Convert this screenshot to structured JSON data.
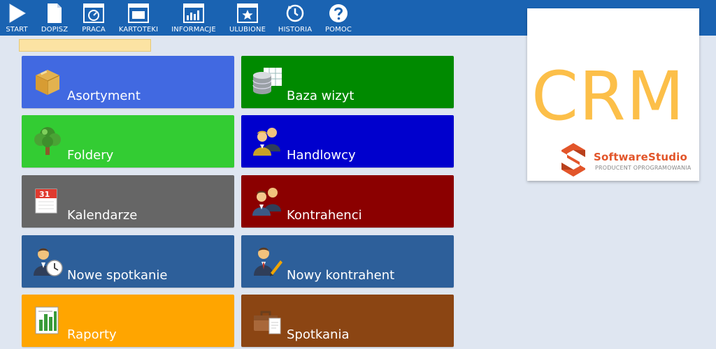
{
  "toolbar": {
    "items": [
      {
        "label": "START",
        "icon": "play-icon"
      },
      {
        "label": "DOPISZ",
        "icon": "document-icon"
      },
      {
        "label": "PRACA",
        "icon": "gauge-icon"
      },
      {
        "label": "KARTOTEKI",
        "icon": "window-icon"
      },
      {
        "label": "INFORMACJE",
        "icon": "bar-chart-icon"
      },
      {
        "label": "ULUBIONE",
        "icon": "star-icon"
      },
      {
        "label": "HISTORIA",
        "icon": "history-icon"
      },
      {
        "label": "POMOC",
        "icon": "help-icon"
      }
    ]
  },
  "search": {
    "value": ""
  },
  "tiles": [
    {
      "label": "Asortyment",
      "color": "#4169e1",
      "icon": "box-icon"
    },
    {
      "label": "Baza wizyt",
      "color": "#008a00",
      "icon": "database-icon"
    },
    {
      "label": "Foldery",
      "color": "#33cc33",
      "icon": "tree-icon"
    },
    {
      "label": "Handlowcy",
      "color": "#0000cd",
      "icon": "users-icon"
    },
    {
      "label": "Kalendarze",
      "color": "#666666",
      "icon": "calendar-icon"
    },
    {
      "label": "Kontrahenci",
      "color": "#8b0000",
      "icon": "contacts-icon"
    },
    {
      "label": "Nowe spotkanie",
      "color": "#2d5f9a",
      "icon": "user-clock-icon"
    },
    {
      "label": "Nowy kontrahent",
      "color": "#2d5f9a",
      "icon": "user-edit-icon"
    },
    {
      "label": "Raporty",
      "color": "#ffa500",
      "icon": "report-icon"
    },
    {
      "label": "Spotkania",
      "color": "#8b4513",
      "icon": "briefcase-icon"
    }
  ],
  "logo": {
    "title": "CRM",
    "brand_name": "SoftwareStudio",
    "brand_tagline": "PRODUCENT OPROGRAMOWANIA",
    "title_color": "#fcbf49",
    "brand_color": "#e2552a"
  },
  "colors": {
    "toolbar": "#1a63b2",
    "background": "#dfe6f1"
  }
}
